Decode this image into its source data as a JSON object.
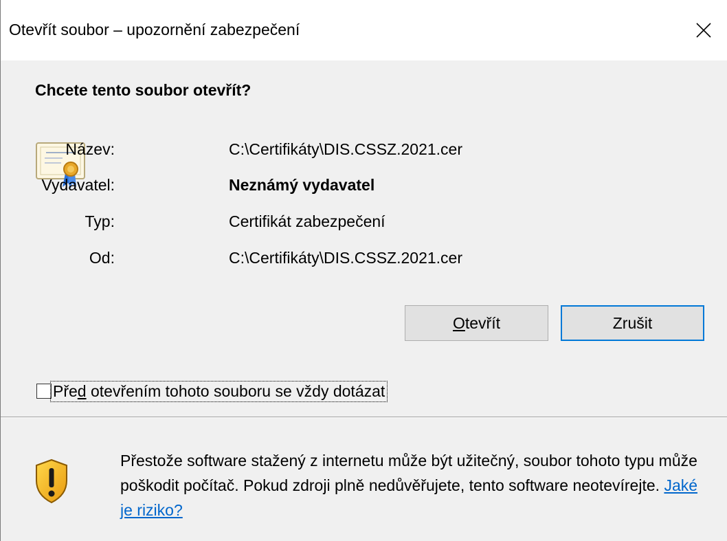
{
  "window": {
    "title": "Otevřít soubor – upozornění zabezpečení"
  },
  "question": "Chcete tento soubor otevřít?",
  "file_info": [
    {
      "label": "Název:",
      "value": "C:\\Certifikáty\\DIS.CSSZ.2021.cer",
      "bold": false
    },
    {
      "label": "Vydavatel:",
      "value": "Neznámý vydavatel",
      "bold": true
    },
    {
      "label": "Typ:",
      "value": "Certifikát zabezpečení",
      "bold": false
    },
    {
      "label": "Od:",
      "value": "C:\\Certifikáty\\DIS.CSSZ.2021.cer",
      "bold": false
    }
  ],
  "buttons": {
    "open_mnemonic": "O",
    "open_rest": "tevřít",
    "cancel": "Zrušit"
  },
  "checkbox": {
    "label_pre": "Pře",
    "label_mnemonic": "d",
    "label_post": " otevřením tohoto souboru se vždy dotázat",
    "checked": false
  },
  "warning": {
    "text": "Přestože software stažený z internetu může být užitečný, soubor tohoto typu může poškodit počítač. Pokud zdroji plně nedůvěřujete, tento software neotevírejte. ",
    "link": "Jaké je riziko?"
  },
  "colors": {
    "accent": "#0078d7",
    "link": "#0066cc",
    "dialog_bg": "#f0f0f0"
  },
  "icons": [
    "close-icon",
    "certificate-icon",
    "shield-warning-icon"
  ]
}
